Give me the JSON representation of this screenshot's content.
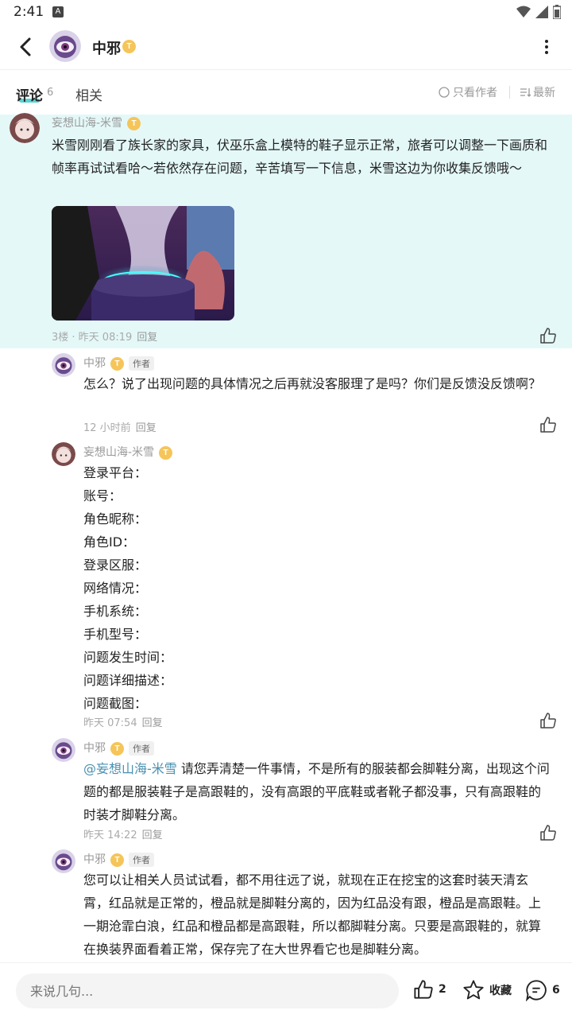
{
  "status": {
    "time": "2:41",
    "a_icon": "A"
  },
  "header": {
    "title": "中邪",
    "level": "T"
  },
  "tabs": {
    "comment": "评论",
    "comment_count": "6",
    "related": "相关",
    "only_author": "只看作者",
    "latest": "最新"
  },
  "main_comment": {
    "author": "妄想山海-米雪",
    "level": "T",
    "text": "米雪刚刚看了族长家的家具，伏巫乐盒上模特的鞋子显示正常，旅者可以调整一下画质和帧率再试试看哈～若依然存在问题，辛苦填写一下信息，米雪这边为你收集反馈哦～",
    "meta": "3楼 · 昨天 08:19",
    "reply": "回复"
  },
  "replies": [
    {
      "author": "中邪",
      "level": "T",
      "badge": "作者",
      "text": "怎么？说了出现问题的具体情况之后再就没客服理了是吗？你们是反馈没反馈啊？",
      "meta": "12 小时前",
      "reply": "回复"
    },
    {
      "author": "妄想山海-米雪",
      "level": "T",
      "lines": [
        "登录平台：",
        "账号：",
        "角色昵称：",
        "角色ID：",
        "登录区服：",
        "网络情况：",
        "手机系统：",
        "手机型号：",
        "问题发生时间：",
        "问题详细描述：",
        "问题截图："
      ],
      "meta": "昨天 07:54",
      "reply": "回复"
    },
    {
      "author": "中邪",
      "level": "T",
      "badge": "作者",
      "mention": "@妄想山海-米雪",
      "text": " 请您弄清楚一件事情，不是所有的服装都会脚鞋分离，出现这个问题的都是服装鞋子是高跟鞋的，没有高跟的平底鞋或者靴子都没事，只有高跟鞋的时装才脚鞋分离。",
      "meta": "昨天 14:22",
      "reply": "回复"
    },
    {
      "author": "中邪",
      "level": "T",
      "badge": "作者",
      "text": "您可以让相关人员试试看，都不用往远了说，就现在正在挖宝的这套时装天清玄霄，红品就是正常的，橙品就是脚鞋分离的，因为红品没有跟，橙品是高跟鞋。上一期沧霏白浪，红品和橙品都是高跟鞋，所以都脚鞋分离。只要是高跟鞋的，就算在换装界面看着正常，保存完了在大世界看它也是脚鞋分离。"
    }
  ],
  "bottom": {
    "placeholder": "来说几句...",
    "like_count": "2",
    "collect": "收藏",
    "comment_count": "6"
  }
}
